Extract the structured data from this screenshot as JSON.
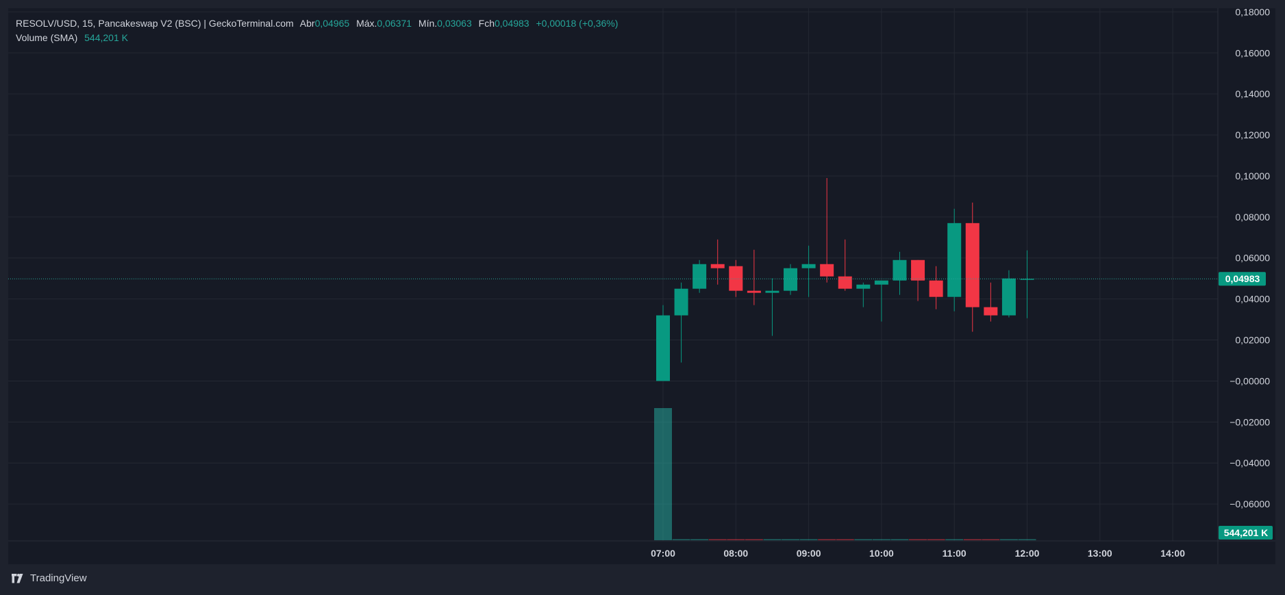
{
  "legend": {
    "symbol": "RESOLV/USD, 15, Pancakeswap V2 (BSC) | GeckoTerminal.com",
    "open_label": "Abr",
    "open": "0,04965",
    "high_label": "Máx.",
    "high": "0,06371",
    "low_label": "Mín.",
    "low": "0,03063",
    "close_label": "Fch",
    "close": "0,04983",
    "change": "+0,00018 (+0,36%)",
    "volume_label": "Volume (SMA)",
    "volume": "544,201 K"
  },
  "footer": {
    "brand": "TradingView",
    "logo_icon": "tradingview-logo-icon"
  },
  "colors": {
    "up": "#089981",
    "down": "#f23645",
    "background": "#161a25",
    "grid": "#242833",
    "axis_text": "#d1d4dc",
    "price_line": "#26a69a"
  },
  "chart_data": {
    "type": "candlestick",
    "interval_minutes": 15,
    "price_axis": {
      "ylim": [
        -0.078,
        0.1818
      ],
      "ticks": [
        0.18,
        0.16,
        0.14,
        0.12,
        0.1,
        0.08,
        0.06,
        0.04,
        0.02,
        -1e-05,
        -0.02,
        -0.04,
        -0.06
      ],
      "tick_labels": [
        "0,18000",
        "0,16000",
        "0,14000",
        "0,12000",
        "0,10000",
        "0,08000",
        "0,06000",
        "0,04000",
        "0,02000",
        "−0,00000",
        "−0,02000",
        "−0,04000",
        "−0,06000"
      ]
    },
    "time_axis": {
      "ticks": [
        "07:00",
        "08:00",
        "09:00",
        "10:00",
        "11:00",
        "12:00",
        "13:00",
        "14:00"
      ]
    },
    "last_price": {
      "value": 0.04983,
      "label": "0,04983"
    },
    "volume_marker": {
      "label": "544,201 K"
    },
    "candles": [
      {
        "time": "07:00",
        "open": 0.0,
        "high": 0.037,
        "low": 0.0,
        "close": 0.032
      },
      {
        "time": "07:15",
        "open": 0.032,
        "high": 0.048,
        "low": 0.009,
        "close": 0.045
      },
      {
        "time": "07:30",
        "open": 0.045,
        "high": 0.059,
        "low": 0.043,
        "close": 0.057
      },
      {
        "time": "07:45",
        "open": 0.057,
        "high": 0.069,
        "low": 0.047,
        "close": 0.055
      },
      {
        "time": "08:00",
        "open": 0.056,
        "high": 0.059,
        "low": 0.041,
        "close": 0.044
      },
      {
        "time": "08:15",
        "open": 0.044,
        "high": 0.064,
        "low": 0.037,
        "close": 0.043
      },
      {
        "time": "08:30",
        "open": 0.043,
        "high": 0.05,
        "low": 0.022,
        "close": 0.044
      },
      {
        "time": "08:45",
        "open": 0.044,
        "high": 0.057,
        "low": 0.042,
        "close": 0.055
      },
      {
        "time": "09:00",
        "open": 0.055,
        "high": 0.066,
        "low": 0.041,
        "close": 0.057
      },
      {
        "time": "09:15",
        "open": 0.057,
        "high": 0.099,
        "low": 0.048,
        "close": 0.051
      },
      {
        "time": "09:30",
        "open": 0.051,
        "high": 0.069,
        "low": 0.044,
        "close": 0.045
      },
      {
        "time": "09:45",
        "open": 0.045,
        "high": 0.048,
        "low": 0.036,
        "close": 0.047
      },
      {
        "time": "10:00",
        "open": 0.047,
        "high": 0.049,
        "low": 0.029,
        "close": 0.049
      },
      {
        "time": "10:15",
        "open": 0.049,
        "high": 0.063,
        "low": 0.042,
        "close": 0.059
      },
      {
        "time": "10:30",
        "open": 0.059,
        "high": 0.059,
        "low": 0.039,
        "close": 0.049
      },
      {
        "time": "10:45",
        "open": 0.049,
        "high": 0.056,
        "low": 0.035,
        "close": 0.041
      },
      {
        "time": "11:00",
        "open": 0.041,
        "high": 0.084,
        "low": 0.034,
        "close": 0.077
      },
      {
        "time": "11:15",
        "open": 0.077,
        "high": 0.087,
        "low": 0.024,
        "close": 0.036
      },
      {
        "time": "11:30",
        "open": 0.036,
        "high": 0.048,
        "low": 0.029,
        "close": 0.032
      },
      {
        "time": "11:45",
        "open": 0.032,
        "high": 0.054,
        "low": 0.031,
        "close": 0.05
      },
      {
        "time": "12:00",
        "open": 0.04965,
        "high": 0.06371,
        "low": 0.03063,
        "close": 0.04983
      }
    ],
    "volume_bars": [
      {
        "time": "07:00",
        "relative": 1.0,
        "direction": "up"
      },
      {
        "time": "07:15",
        "relative": 0.004,
        "direction": "up"
      },
      {
        "time": "07:30",
        "relative": 0.004,
        "direction": "up"
      },
      {
        "time": "07:45",
        "relative": 0.004,
        "direction": "down"
      },
      {
        "time": "08:00",
        "relative": 0.004,
        "direction": "down"
      },
      {
        "time": "08:15",
        "relative": 0.004,
        "direction": "down"
      },
      {
        "time": "08:30",
        "relative": 0.004,
        "direction": "up"
      },
      {
        "time": "08:45",
        "relative": 0.004,
        "direction": "up"
      },
      {
        "time": "09:00",
        "relative": 0.004,
        "direction": "up"
      },
      {
        "time": "09:15",
        "relative": 0.004,
        "direction": "down"
      },
      {
        "time": "09:30",
        "relative": 0.004,
        "direction": "down"
      },
      {
        "time": "09:45",
        "relative": 0.004,
        "direction": "up"
      },
      {
        "time": "10:00",
        "relative": 0.004,
        "direction": "up"
      },
      {
        "time": "10:15",
        "relative": 0.004,
        "direction": "up"
      },
      {
        "time": "10:30",
        "relative": 0.004,
        "direction": "down"
      },
      {
        "time": "10:45",
        "relative": 0.004,
        "direction": "down"
      },
      {
        "time": "11:00",
        "relative": 0.004,
        "direction": "up"
      },
      {
        "time": "11:15",
        "relative": 0.004,
        "direction": "down"
      },
      {
        "time": "11:30",
        "relative": 0.004,
        "direction": "down"
      },
      {
        "time": "11:45",
        "relative": 0.004,
        "direction": "up"
      },
      {
        "time": "12:00",
        "relative": 0.004,
        "direction": "up"
      }
    ]
  }
}
